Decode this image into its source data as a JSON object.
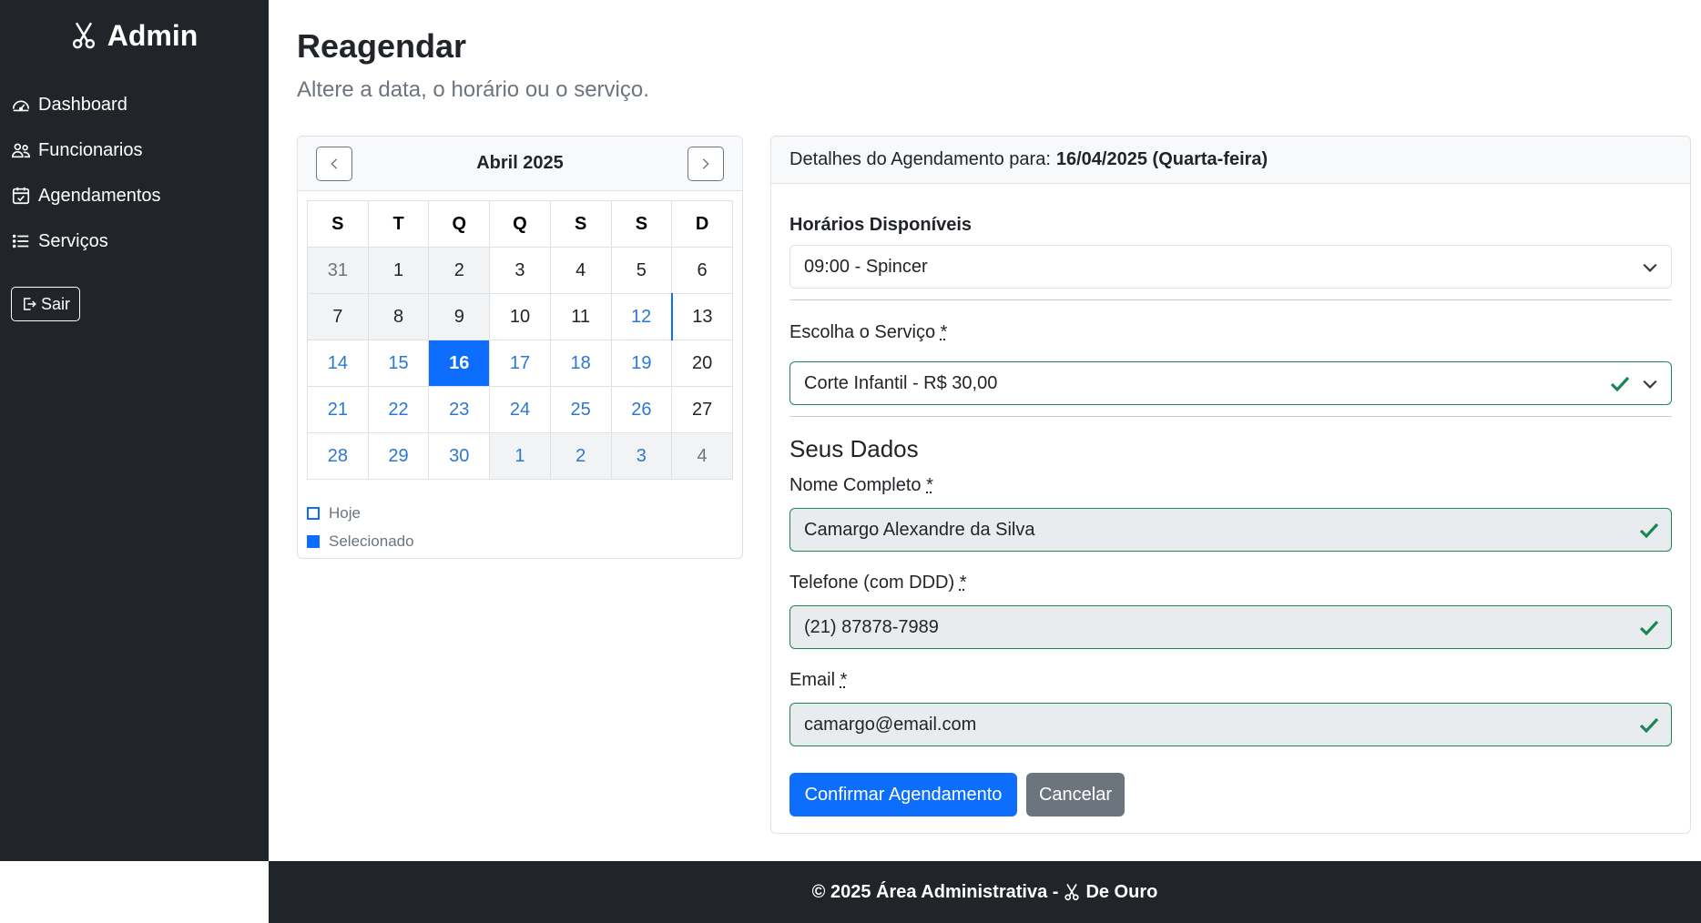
{
  "sidebar": {
    "brand": "Admin",
    "brand_icon": "scissors-icon",
    "items": [
      {
        "label": "Dashboard",
        "icon": "speedometer-icon"
      },
      {
        "label": "Funcionarios",
        "icon": "people-icon"
      },
      {
        "label": "Agendamentos",
        "icon": "calendar-check-icon"
      },
      {
        "label": "Serviços",
        "icon": "list-icon"
      }
    ],
    "logout_label": "Sair"
  },
  "page": {
    "title": "Reagendar",
    "subtitle": "Altere a data, o horário ou o serviço."
  },
  "calendar": {
    "month_label": "Abril 2025",
    "weekdays": [
      "S",
      "T",
      "Q",
      "Q",
      "S",
      "S",
      "D"
    ],
    "weeks": [
      [
        {
          "d": "31",
          "s": "muted"
        },
        {
          "d": "1",
          "s": "past"
        },
        {
          "d": "2",
          "s": "past"
        },
        {
          "d": "3",
          "s": "plain"
        },
        {
          "d": "4",
          "s": "plain"
        },
        {
          "d": "5",
          "s": "plain"
        },
        {
          "d": "6",
          "s": "plain"
        }
      ],
      [
        {
          "d": "7",
          "s": "past"
        },
        {
          "d": "8",
          "s": "past"
        },
        {
          "d": "9",
          "s": "past"
        },
        {
          "d": "10",
          "s": "plain"
        },
        {
          "d": "11",
          "s": "plain"
        },
        {
          "d": "12",
          "s": "avail-today"
        },
        {
          "d": "13",
          "s": "plain"
        }
      ],
      [
        {
          "d": "14",
          "s": "avail"
        },
        {
          "d": "15",
          "s": "avail"
        },
        {
          "d": "16",
          "s": "selected"
        },
        {
          "d": "17",
          "s": "avail"
        },
        {
          "d": "18",
          "s": "avail"
        },
        {
          "d": "19",
          "s": "avail"
        },
        {
          "d": "20",
          "s": "plain"
        }
      ],
      [
        {
          "d": "21",
          "s": "avail"
        },
        {
          "d": "22",
          "s": "avail"
        },
        {
          "d": "23",
          "s": "avail"
        },
        {
          "d": "24",
          "s": "avail"
        },
        {
          "d": "25",
          "s": "avail"
        },
        {
          "d": "26",
          "s": "avail"
        },
        {
          "d": "27",
          "s": "plain"
        }
      ],
      [
        {
          "d": "28",
          "s": "avail"
        },
        {
          "d": "29",
          "s": "avail"
        },
        {
          "d": "30",
          "s": "avail"
        },
        {
          "d": "1",
          "s": "muted-avail"
        },
        {
          "d": "2",
          "s": "muted-avail"
        },
        {
          "d": "3",
          "s": "muted-avail"
        },
        {
          "d": "4",
          "s": "muted"
        }
      ]
    ],
    "legend": {
      "today": "Hoje",
      "selected": "Selecionado"
    }
  },
  "details": {
    "header_prefix": "Detalhes do Agendamento para:",
    "header_date": "16/04/2025 (Quarta-feira)",
    "slots_label": "Horários Disponíveis",
    "slots_value": "09:00 - Spincer",
    "service_label": "Escolha o Serviço",
    "service_value": "Corte Infantil - R$ 30,00",
    "section_title": "Seus Dados",
    "name_label": "Nome Completo",
    "name_value": "Camargo Alexandre da Silva",
    "phone_label": "Telefone (com DDD)",
    "phone_value": "(21) 87878-7989",
    "email_label": "Email",
    "email_value": "camargo@email.com",
    "required_mark": "*",
    "confirm_label": "Confirmar Agendamento",
    "cancel_label": "Cancelar"
  },
  "footer": {
    "prefix": "© 2025 Área Administrativa -",
    "brand": "De Ouro"
  },
  "colors": {
    "sidebar_bg": "#212529",
    "primary": "#0d6efd",
    "success": "#198754",
    "secondary": "#6c757d",
    "available_day": "#2b78d4"
  }
}
